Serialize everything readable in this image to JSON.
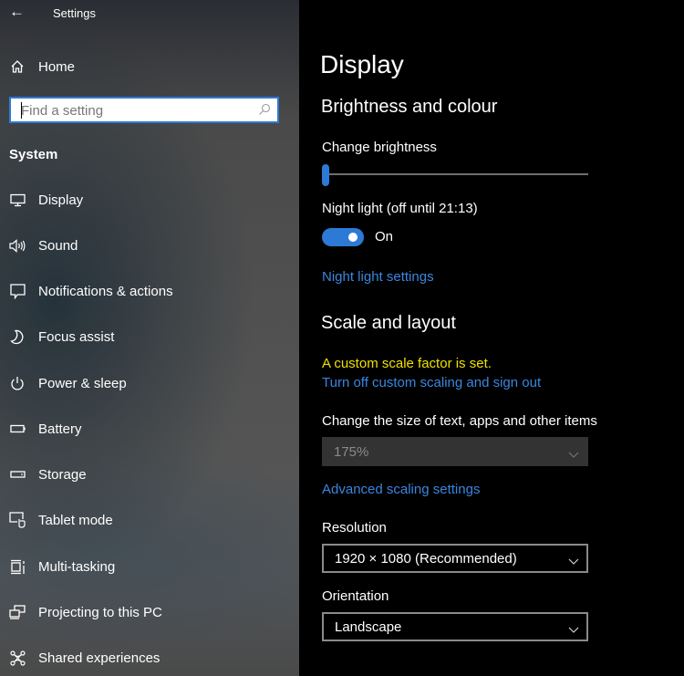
{
  "window": {
    "title": "Settings"
  },
  "sidebar": {
    "home_label": "Home",
    "search": {
      "placeholder": "Find a setting",
      "value": ""
    },
    "section_label": "System",
    "items": [
      {
        "label": "Display",
        "icon": "monitor-icon"
      },
      {
        "label": "Sound",
        "icon": "speaker-icon"
      },
      {
        "label": "Notifications & actions",
        "icon": "notification-icon"
      },
      {
        "label": "Focus assist",
        "icon": "moon-icon"
      },
      {
        "label": "Power & sleep",
        "icon": "power-icon"
      },
      {
        "label": "Battery",
        "icon": "battery-icon"
      },
      {
        "label": "Storage",
        "icon": "storage-icon"
      },
      {
        "label": "Tablet mode",
        "icon": "tablet-mode-icon"
      },
      {
        "label": "Multi-tasking",
        "icon": "multitasking-icon"
      },
      {
        "label": "Projecting to this PC",
        "icon": "projecting-icon"
      },
      {
        "label": "Shared experiences",
        "icon": "shared-experiences-icon"
      }
    ]
  },
  "main": {
    "title": "Display",
    "brightness_section": {
      "heading": "Brightness and colour",
      "brightness_label": "Change brightness",
      "brightness_value": 0,
      "night_light_label": "Night light (off until 21:13)",
      "night_light_state": "On",
      "night_light_on": true,
      "night_light_settings_link": "Night light settings"
    },
    "scale_section": {
      "heading": "Scale and layout",
      "custom_scale_warning": "A custom scale factor is set.",
      "turn_off_link": "Turn off custom scaling and sign out",
      "size_label": "Change the size of text, apps and other items",
      "size_value": "175%",
      "advanced_link": "Advanced scaling settings",
      "resolution_label": "Resolution",
      "resolution_value": "1920 × 1080 (Recommended)",
      "orientation_label": "Orientation",
      "orientation_value": "Landscape"
    }
  },
  "colors": {
    "accent": "#2d7ad6",
    "link": "#3a86e0",
    "warning": "#f0e000"
  }
}
